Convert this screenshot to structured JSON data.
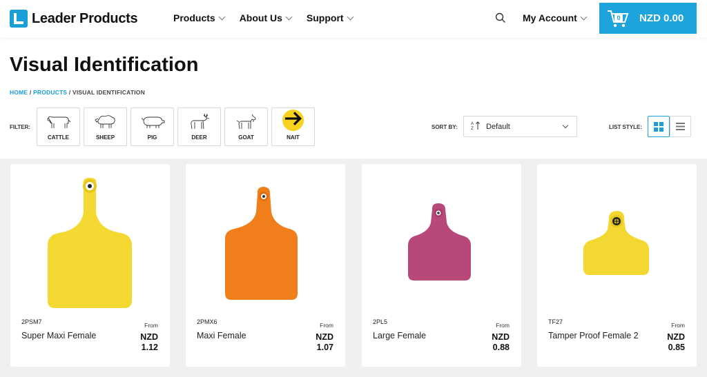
{
  "header": {
    "brand": "Leader Products",
    "nav": [
      "Products",
      "About Us",
      "Support"
    ],
    "account_label": "My Account",
    "cart_count": "0",
    "cart_total": "NZD 0.00"
  },
  "page": {
    "title": "Visual Identification",
    "breadcrumb": {
      "home": "HOME",
      "products": "PRODUCTS",
      "current": "VISUAL IDENTIFICATION",
      "sep": " / "
    }
  },
  "filters": {
    "label": "FILTER:",
    "items": [
      "CATTLE",
      "SHEEP",
      "PIG",
      "DEER",
      "GOAT",
      "NAIT"
    ]
  },
  "sort": {
    "label": "SORT BY:",
    "value": "Default"
  },
  "list_style": {
    "label": "LIST STYLE:"
  },
  "products": [
    {
      "code": "2PSM7",
      "name": "Super Maxi Female",
      "from": "From",
      "currency": "NZD",
      "price": "1.12",
      "color": "#f5d933"
    },
    {
      "code": "2PMX6",
      "name": "Maxi Female",
      "from": "From",
      "currency": "NZD",
      "price": "1.07",
      "color": "#f07f1b"
    },
    {
      "code": "2PL5",
      "name": "Large Female",
      "from": "From",
      "currency": "NZD",
      "price": "0.88",
      "color": "#b8477a"
    },
    {
      "code": "TF27",
      "name": "Tamper Proof Female 2",
      "from": "From",
      "currency": "NZD",
      "price": "0.85",
      "color": "#f4d832"
    }
  ],
  "colors": {
    "accent": "#1da4dc",
    "nait_yellow": "#f7d21e"
  }
}
